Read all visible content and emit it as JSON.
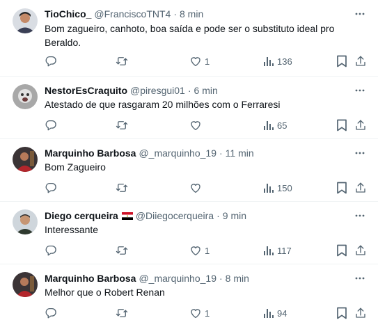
{
  "tweets": [
    {
      "name": "TioChico_",
      "handle": "@FranciscoTNT4",
      "time": "8 min",
      "text": "Bom zagueiro, canhoto, boa saída e pode ser o substituto ideal pro Beraldo.",
      "likes": "1",
      "views": "136",
      "flag": false
    },
    {
      "name": "NestorEsCraquito",
      "handle": "@piresgui01",
      "time": "6 min",
      "text": "Atestado de que rasgaram 20 milhões com o Ferraresi",
      "likes": "",
      "views": "65",
      "flag": false
    },
    {
      "name": "Marquinho Barbosa",
      "handle": "@_marquinho_19",
      "time": "11 min",
      "text": "Bom Zagueiro",
      "likes": "",
      "views": "150",
      "flag": false
    },
    {
      "name": "Diego cerqueira",
      "handle": "@Diiegocerqueira",
      "time": "9 min",
      "text": "Interessante",
      "likes": "1",
      "views": "117",
      "flag": true
    },
    {
      "name": "Marquinho Barbosa",
      "handle": "@_marquinho_19",
      "time": "8 min",
      "text": "Melhor que o Robert Renan",
      "likes": "1",
      "views": "94",
      "flag": false
    }
  ],
  "icons": {
    "more": "more-horizontal-icon",
    "reply": "reply-icon",
    "retweet": "retweet-icon",
    "like": "heart-icon",
    "views": "views-chart-icon",
    "bookmark": "bookmark-icon",
    "share": "share-icon"
  },
  "colors": {
    "text": "#0f1419",
    "muted": "#536471",
    "divider": "#eff3f4"
  }
}
